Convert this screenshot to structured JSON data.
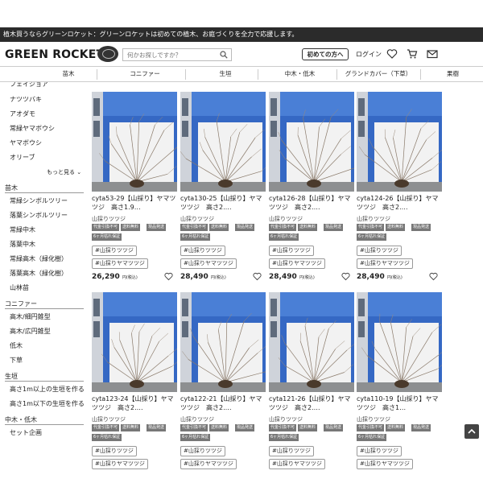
{
  "topbar": {
    "text": "植木買うならグリーンロケット：グリーンロケットは初めての植木、お庭づくりを全力で応援します。"
  },
  "header": {
    "logo": "GREEN ROCKET",
    "search_placeholder": "何かお探しですか？",
    "first_time_button": "初めての方へ",
    "login": "ログイン"
  },
  "nav": {
    "items": [
      "苗木",
      "コニファー",
      "生垣",
      "中木・低木",
      "グランドカバー（下草）",
      "果樹"
    ]
  },
  "sidebar": {
    "top_items": [
      "フェイジョア",
      "ナツツバキ",
      "アオダモ",
      "常緑ヤマボウシ",
      "ヤマボウシ",
      "オリーブ"
    ],
    "more": "もっと見る",
    "sections": [
      {
        "title": "苗木",
        "items": [
          "常緑シンボルツリー",
          "落葉シンボルツリー",
          "常緑中木",
          "落葉中木",
          "常緑高木（緑化樹）",
          "落葉高木（緑化樹）",
          "山林苗"
        ]
      },
      {
        "title": "コニファー",
        "items": [
          "高木/細円錐型",
          "高木/広円錐型",
          "低木",
          "下草"
        ]
      },
      {
        "title": "生垣",
        "items": [
          "高さ1m以上の生垣を作る",
          "高さ1m以下の生垣を作る"
        ]
      },
      {
        "title": "中木・低木",
        "items": [
          "セット企画"
        ]
      }
    ]
  },
  "tags": [
    "代金引換不可",
    "送料無料",
    "現品発送",
    "6ヶ月枯れ保証"
  ],
  "hashtags": [
    "#山採りツツジ",
    "#山採りヤマツツジ"
  ],
  "price_note": "円(税込)",
  "products": [
    {
      "title": "cyta53-29【山採り】ヤマツツジ　高さ1.9…",
      "category": "山採りツツジ",
      "price": "26,290"
    },
    {
      "title": "cyta130-25【山採り】ヤマツツジ　高さ2.…",
      "category": "山採りツツジ",
      "price": "28,490"
    },
    {
      "title": "cyta126-28【山採り】ヤマツツジ　高さ2.…",
      "category": "山採りツツジ",
      "price": "28,490"
    },
    {
      "title": "cyta124-26【山採り】ヤマツツジ　高さ2.…",
      "category": "山採りツツジ",
      "price": "28,490"
    },
    {
      "title": "cyta123-24【山採り】ヤマツツジ　高さ2.…",
      "category": "山採りツツジ",
      "price": ""
    },
    {
      "title": "cyta122-21【山採り】ヤマツツジ　高さ2.…",
      "category": "山採りツツジ",
      "price": ""
    },
    {
      "title": "cyta121-26【山採り】ヤマツツジ　高さ2.…",
      "category": "山採りツツジ",
      "price": ""
    },
    {
      "title": "cyta110-19【山採り】ヤマツツジ　高さ1…",
      "category": "山採りツツジ",
      "price": ""
    }
  ]
}
